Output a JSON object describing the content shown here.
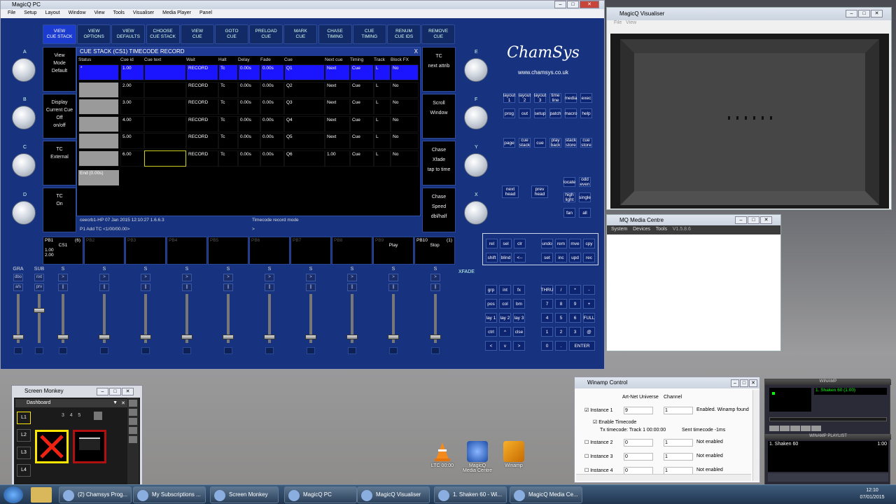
{
  "magicq": {
    "title": "MagicQ PC",
    "menu": [
      "File",
      "Setup",
      "Layout",
      "Window",
      "View",
      "Tools",
      "Visualiser",
      "Media Player",
      "Panel"
    ],
    "top_buttons": [
      "VIEW\nCUE STACK",
      "VIEW\nOPTIONS",
      "VIEW\nDEFAULTS",
      "CHOOSE\nCUE STACK",
      "VIEW\nCUE",
      "GOTO\nCUE",
      "PRELOAD\nCUE",
      "MARK\nCUE",
      "CHASE\nTIMING",
      "CUE\nTIMING",
      "RENUM\nCUE IDS",
      "REMOVE\nCUE"
    ],
    "knob_labels_left": [
      "A",
      "B",
      "C",
      "D"
    ],
    "knob_labels_right": [
      "E",
      "F",
      "Y",
      "X"
    ],
    "left_panels": [
      [
        "View",
        "Mode",
        "",
        "Default"
      ],
      [
        "Display",
        "Current Cue",
        "Off",
        "on/off"
      ],
      [
        "TC",
        "External"
      ],
      [
        "TC",
        "On"
      ]
    ],
    "right_panels": [
      [
        "TC",
        "",
        "next attrib"
      ],
      [
        "Scroll",
        "Window"
      ],
      [
        "Chase",
        "Xfade",
        "tap to time"
      ],
      [
        "Chase",
        "Speed",
        "dbl/half"
      ]
    ],
    "cue_window": {
      "title": "CUE STACK (CS1) TIMECODE RECORD",
      "close": "X",
      "columns": [
        "Status",
        "Cue id",
        "Cue text",
        "Wait",
        "Halt",
        "Delay",
        "Fade",
        "Cue",
        "Next cue",
        "Timing",
        "Track",
        "Block FX"
      ],
      "rows": [
        {
          "status": "*",
          "id": "1.00",
          "wait": "RECORD",
          "halt": "Tc",
          "delay": "0.00s",
          "fade": "0.00s",
          "cue": "Q1",
          "next": "Next",
          "timing": "Cue",
          "track": "L",
          "block": "No"
        },
        {
          "status": "",
          "id": "2.00",
          "wait": "RECORD",
          "halt": "Tc",
          "delay": "0.00s",
          "fade": "0.00s",
          "cue": "Q2",
          "next": "Next",
          "timing": "Cue",
          "track": "L",
          "block": "No"
        },
        {
          "status": "",
          "id": "3.00",
          "wait": "RECORD",
          "halt": "Tc",
          "delay": "0.00s",
          "fade": "0.00s",
          "cue": "Q3",
          "next": "Next",
          "timing": "Cue",
          "track": "L",
          "block": "No"
        },
        {
          "status": "",
          "id": "4.00",
          "wait": "RECORD",
          "halt": "Tc",
          "delay": "0.00s",
          "fade": "0.00s",
          "cue": "Q4",
          "next": "Next",
          "timing": "Cue",
          "track": "L",
          "block": "No"
        },
        {
          "status": "",
          "id": "5.00",
          "wait": "RECORD",
          "halt": "Tc",
          "delay": "0.00s",
          "fade": "0.00s",
          "cue": "Q5",
          "next": "Next",
          "timing": "Cue",
          "track": "L",
          "block": "No"
        },
        {
          "status": "",
          "id": "6.00",
          "wait": "RECORD",
          "halt": "Tc",
          "delay": "0.00s",
          "fade": "0.00s",
          "cue": "Q6",
          "next": "1.00",
          "timing": "Cue",
          "track": "L",
          "block": "No"
        }
      ],
      "end_label": "End (0.00s)"
    },
    "status_line": "ceecrb1-HP 07 Jan 2015 12:10:27 1.6.6.3",
    "mode_line": "Timecode record mode",
    "command_line": "P1  Add  TC <1/00/00.00>",
    "command_prompt": ">",
    "logo": "ChamSys",
    "url": "www.chamsys.co.uk",
    "window_keys": [
      "layout\n1",
      "layout\n2",
      "layout\n3",
      "time\nline",
      "media",
      "exec",
      "prog",
      "out",
      "setup",
      "patch",
      "macro",
      "help"
    ],
    "stack_keys": [
      "page",
      "cue\nstack",
      "cue",
      "play\nback",
      "stack\nstore",
      "cue\nstore"
    ],
    "head_keys": [
      "next\nhead",
      "prev\nhead"
    ],
    "locate_keys": [
      "locate",
      "odd\neven",
      "high\nlight",
      "single",
      "fan",
      "all"
    ],
    "sel_keys": [
      "rel",
      "sel",
      "clr",
      "shift",
      "blind",
      "<--",
      "undo",
      "rem",
      "mve",
      "cpy",
      "set",
      "inc",
      "upd",
      "rec"
    ],
    "group_keys": [
      "grp",
      "int",
      "fx",
      "pos",
      "col",
      "bm",
      "lay 1",
      "lay 2",
      "lay 3",
      "ctrl",
      "^",
      "clse",
      "<",
      "v",
      ">"
    ],
    "num_keys": [
      "THRU",
      "/",
      "*",
      "-",
      "7",
      "8",
      "9",
      "+",
      "4",
      "5",
      "6",
      "FULL",
      "1",
      "2",
      "3",
      "@",
      "0",
      ".",
      "ENTER"
    ],
    "playbacks": [
      {
        "id": "PB1",
        "count": "(6)",
        "name": "CS1",
        "lines": [
          "1.00",
          "2.00"
        ]
      },
      {
        "id": "PB2"
      },
      {
        "id": "PB3"
      },
      {
        "id": "PB4"
      },
      {
        "id": "PB5"
      },
      {
        "id": "PB6"
      },
      {
        "id": "PB7"
      },
      {
        "id": "PB8"
      },
      {
        "id": "PB9",
        "name": "Play"
      },
      {
        "id": "PB10",
        "count": "(1)",
        "name": "Stop"
      }
    ],
    "fader_labels": {
      "gra": "GRA",
      "sub": "SUB",
      "xfade": "XFADE",
      "s": "S",
      "dbo": "dbo",
      "nxt": "nxt",
      "a_s": "a/s",
      "prv": "prv"
    }
  },
  "visualiser": {
    "title": "MagicQ Visualiser",
    "menu": [
      "File",
      "View"
    ]
  },
  "media_centre": {
    "title": "MQ Media Centre",
    "menu": [
      "System",
      "Devices",
      "Tools"
    ],
    "version": "V1.5.8.6"
  },
  "screen_monkey": {
    "title": "Screen Monkey",
    "tab": "Dashboard",
    "layers": [
      "L1",
      "L2",
      "L3",
      "L4"
    ],
    "pages": [
      "3",
      "4",
      "5"
    ]
  },
  "winamp_control": {
    "title": "Winamp Control",
    "header_universe": "Art-Net Universe",
    "header_channel": "Channel",
    "instances": [
      {
        "label": "Instance 1",
        "checked": true,
        "uni": "9",
        "ch": "1",
        "status": "Enabled. Winamp found"
      },
      {
        "label": "Instance 2",
        "checked": false,
        "uni": "0",
        "ch": "1",
        "status": "Not enabled"
      },
      {
        "label": "Instance 3",
        "checked": false,
        "uni": "0",
        "ch": "1",
        "status": "Not enabled"
      },
      {
        "label": "Instance 4",
        "checked": false,
        "uni": "0",
        "ch": "1",
        "status": "Not enabled"
      }
    ],
    "enable_timecode": "Enable Timecode",
    "tx_timecode": "Tx timecode: Track 1 00:00:00",
    "sent_timecode": "Sent timecode -1ms"
  },
  "winamp": {
    "title": "WINAMP",
    "track": "1. Shaken 60 (1:00)",
    "playlist_title": "WINAMP PLAYLIST",
    "playlist": [
      {
        "name": "1. Shaken 60",
        "time": "1:00"
      }
    ]
  },
  "desktop_icons": [
    "LTC 00:00",
    "MagicQ\nMedia Centre",
    "Winamp"
  ],
  "taskbar": {
    "items": [
      "(2) Chamsys Prog...",
      "My Subscriptions ...",
      "Screen Monkey",
      "MagicQ PC",
      "MagicQ Visualiser",
      "1. Shaken 60 - Wi...",
      "MagicQ Media Ce..."
    ],
    "time": "12:10",
    "date": "07/01/2015"
  }
}
